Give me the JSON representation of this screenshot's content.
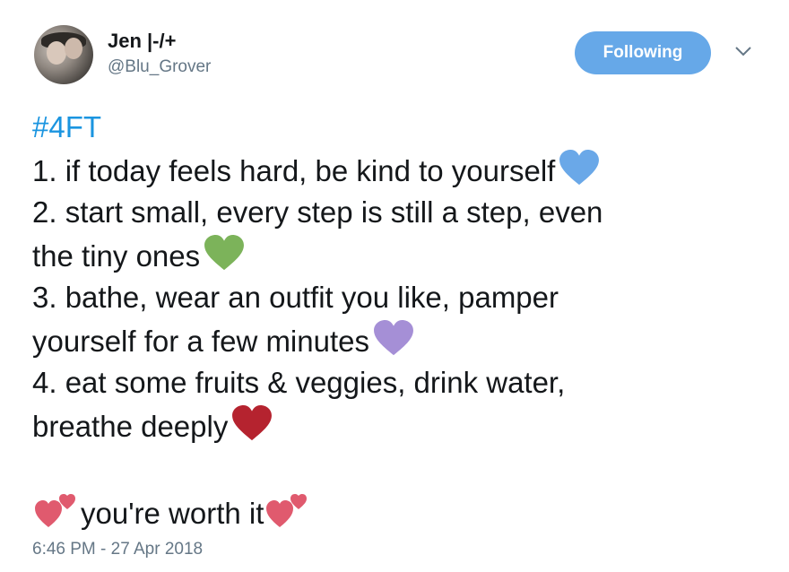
{
  "user": {
    "name": "Jen |-/+",
    "handle": "@Blu_Grover"
  },
  "follow_button": {
    "label": "Following"
  },
  "tweet": {
    "hashtag": "#4FT",
    "lines": [
      "1. if today feels hard, be kind to yourself",
      "2. start small, every step is still a step, even",
      "the tiny ones",
      "3. bathe, wear an outfit you like, pamper",
      "yourself for a few minutes",
      "4. eat some fruits & veggies, drink water,",
      "breathe deeply"
    ],
    "closing": "you're worth it"
  },
  "timestamp": "6:46 PM - 27 Apr 2018",
  "icons": {
    "heart_1": {
      "name": "blue-heart-icon",
      "color": "#6aa8e8"
    },
    "heart_2": {
      "name": "green-heart-icon",
      "color": "#7cb35a"
    },
    "heart_3": {
      "name": "purple-heart-icon",
      "color": "#a58fd6"
    },
    "heart_4": {
      "name": "red-heart-icon",
      "color": "#b5232f"
    },
    "two_hearts": {
      "name": "two-hearts-icon",
      "color": "#e05a6e"
    }
  },
  "colors": {
    "accent": "#1b95e0",
    "button": "#66a8e8",
    "secondary_text": "#657786"
  }
}
